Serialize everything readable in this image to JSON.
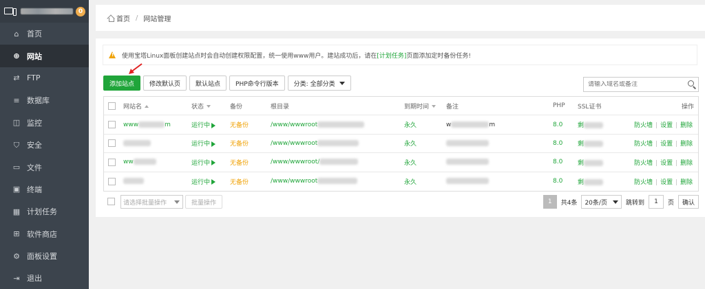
{
  "sidebar": {
    "badge": "0",
    "items": [
      {
        "label": "首页",
        "icon": "home-icon",
        "glyph": "⌂"
      },
      {
        "label": "网站",
        "icon": "globe-icon",
        "glyph": "⊕"
      },
      {
        "label": "FTP",
        "icon": "ftp-icon",
        "glyph": "⇄"
      },
      {
        "label": "数据库",
        "icon": "database-icon",
        "glyph": "≡"
      },
      {
        "label": "监控",
        "icon": "monitor-chart-icon",
        "glyph": "◫"
      },
      {
        "label": "安全",
        "icon": "shield-icon",
        "glyph": "⛉"
      },
      {
        "label": "文件",
        "icon": "folder-icon",
        "glyph": "▭"
      },
      {
        "label": "终端",
        "icon": "terminal-icon",
        "glyph": "▣"
      },
      {
        "label": "计划任务",
        "icon": "calendar-icon",
        "glyph": "▦"
      },
      {
        "label": "软件商店",
        "icon": "apps-icon",
        "glyph": "⊞"
      },
      {
        "label": "面板设置",
        "icon": "settings-icon",
        "glyph": "⚙"
      },
      {
        "label": "退出",
        "icon": "logout-icon",
        "glyph": "⇥"
      }
    ]
  },
  "breadcrumb": {
    "home": "首页",
    "sep": "/",
    "current": "网站管理"
  },
  "notice": {
    "text_before": "使用宝塔Linux面板创建站点时会自动创建权限配置，统一使用www用户。建站成功后，请在",
    "link": "[计划任务]",
    "text_after": "页面添加定时备份任务!"
  },
  "toolbar": {
    "add_site": "添加站点",
    "edit_default_page": "修改默认页",
    "default_site": "默认站点",
    "php_cli": "PHP命令行版本",
    "category": "分类: 全部分类"
  },
  "search": {
    "placeholder": "请输入域名或备注"
  },
  "table": {
    "headers": {
      "name": "网站名",
      "status": "状态",
      "backup": "备份",
      "root": "根目录",
      "expire": "到期时间",
      "remark": "备注",
      "php": "PHP",
      "ssl": "SSL证书",
      "ops": "操作"
    },
    "rows": [
      {
        "name": "www",
        "name_tail": "m",
        "status": "运行中",
        "backup": "无备份",
        "root": "/www/wwwroot",
        "expire": "永久",
        "remark": "w",
        "remark_tail": "m",
        "php": "8.0",
        "ssl": "剩"
      },
      {
        "name": "",
        "name_tail": "",
        "status": "运行中",
        "backup": "无备份",
        "root": "/www/wwwroot",
        "expire": "永久",
        "remark": "",
        "remark_tail": "",
        "php": "8.0",
        "ssl": "剩"
      },
      {
        "name": "ww",
        "name_tail": "",
        "status": "运行中",
        "backup": "无备份",
        "root": "/www/wwwroot/",
        "expire": "永久",
        "remark": "",
        "remark_tail": "",
        "php": "8.0",
        "ssl": "剩"
      },
      {
        "name": "",
        "name_tail": "",
        "status": "运行中",
        "backup": "无备份",
        "root": "/www/wwwroot",
        "expire": "永久",
        "remark": "",
        "remark_tail": "",
        "php": "8.0",
        "ssl": "剩"
      }
    ],
    "ops": {
      "firewall": "防火墙",
      "settings": "设置",
      "delete": "删除",
      "sep": "|"
    }
  },
  "footer": {
    "batch_placeholder": "请选择批量操作",
    "batch_button": "批量操作",
    "page_current": "1",
    "total": "共4条",
    "page_size": "20条/页",
    "jump_to": "跳转到",
    "jump_value": "1",
    "page_unit": "页",
    "confirm": "确认"
  }
}
